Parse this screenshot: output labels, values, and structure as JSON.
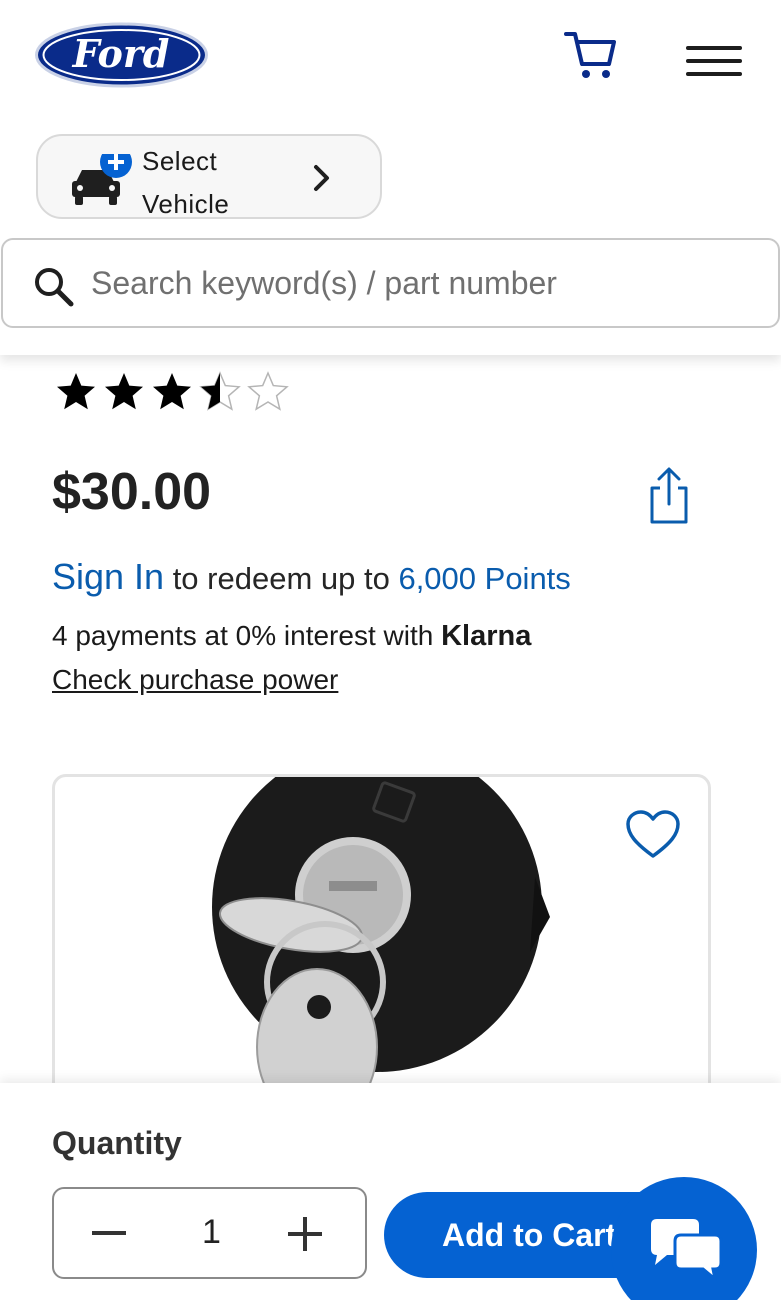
{
  "brand": {
    "logo_text": "Ford",
    "primary_color": "#0a2b8a",
    "accent_color": "#0562d2"
  },
  "header": {
    "vehicle_select_label": "Select Vehicle",
    "search_placeholder": "Search keyword(s) / part number"
  },
  "product": {
    "rating": 3.5,
    "rating_max": 5,
    "price": "$30.00",
    "points": {
      "sign_in": "Sign In",
      "middle_text": " to redeem up to ",
      "points_text": "6,000 Points"
    },
    "klarna": {
      "text": "4 payments at 0% interest with ",
      "brand": "Klarna",
      "check_link": "Check purchase power"
    }
  },
  "purchase": {
    "quantity_label": "Quantity",
    "quantity_value": "1",
    "add_to_cart_label": "Add to Cart"
  },
  "icons": [
    "cart-icon",
    "menu-icon",
    "car-icon",
    "plus-badge-icon",
    "chevron-right-icon",
    "search-icon",
    "star-icon",
    "share-icon",
    "heart-icon",
    "chat-icon"
  ]
}
